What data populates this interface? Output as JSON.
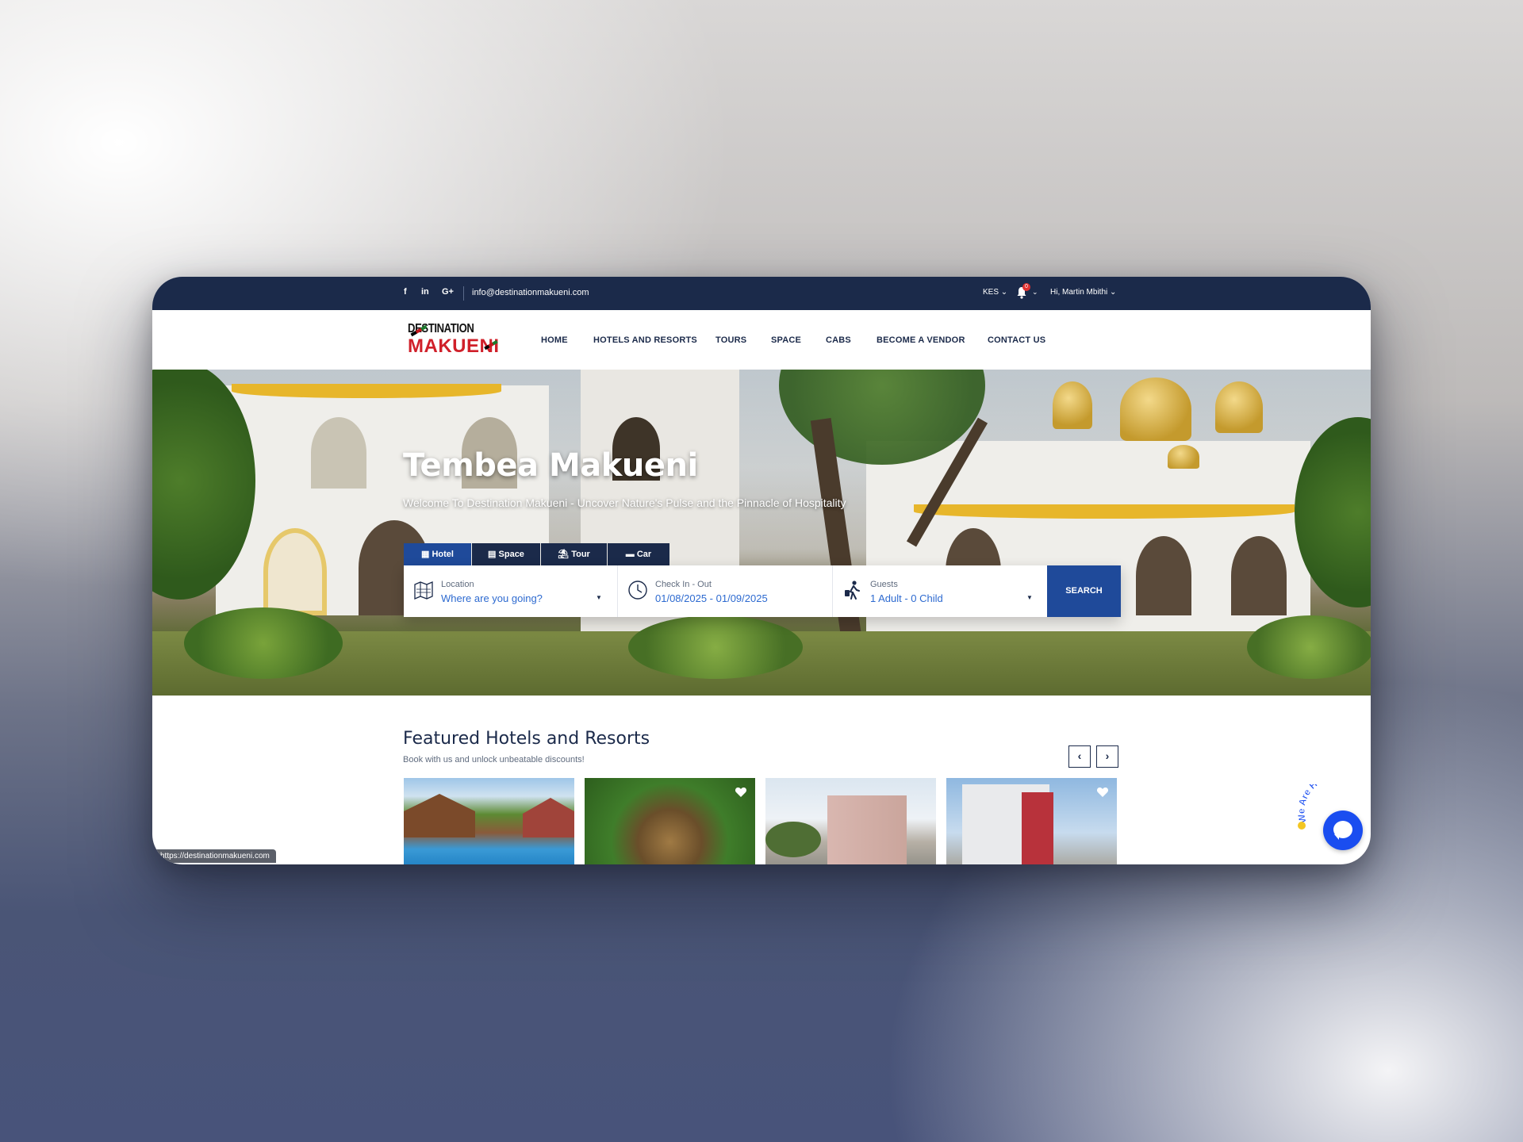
{
  "topbar": {
    "social": [
      "f",
      "in",
      "G+"
    ],
    "social_icons": [
      "facebook-icon",
      "linkedin-icon",
      "google-plus-icon"
    ],
    "email": "info@destinationmakueni.com",
    "currency": "KES",
    "notification_count": "0",
    "user_greeting": "Hi, Martin Mbithi"
  },
  "brand": {
    "logo_line1": "DESTINATION",
    "logo_line2": "MAKUENI"
  },
  "nav": {
    "items": [
      "HOME",
      "HOTELS AND RESORTS",
      "TOURS",
      "SPACE",
      "CABS",
      "BECOME A VENDOR",
      "CONTACT US"
    ]
  },
  "hero": {
    "title": "Tembea Makueni",
    "subtitle": "Welcome To Destination Makueni - Uncover Nature's Pulse and the Pinnacle of Hospitality"
  },
  "search": {
    "tabs": [
      {
        "label": "Hotel",
        "icon": "building-icon",
        "active": true
      },
      {
        "label": "Space",
        "icon": "office-icon",
        "active": false
      },
      {
        "label": "Tour",
        "icon": "beach-umbrella-icon",
        "active": false
      },
      {
        "label": "Car",
        "icon": "car-icon",
        "active": false
      }
    ],
    "location_label": "Location",
    "location_placeholder": "Where are you going?",
    "dates_label": "Check In - Out",
    "dates_value": "01/08/2025 - 01/09/2025",
    "guests_label": "Guests",
    "guests_value": "1 Adult - 0 Child",
    "button_label": "SEARCH"
  },
  "featured": {
    "title": "Featured Hotels and Resorts",
    "subtitle": "Book with us and unlock unbeatable discounts!",
    "prev_label": "‹",
    "next_label": "›"
  },
  "statusbar": {
    "url": "https://destinationmakueni.com"
  },
  "chat": {
    "badge_text": "We Are Here!"
  },
  "colors": {
    "navy": "#1b2a4a",
    "primary_blue": "#1f4a9a",
    "link_blue": "#2d6ad0",
    "chat_blue": "#1a4df0",
    "logo_red": "#d0202a"
  }
}
